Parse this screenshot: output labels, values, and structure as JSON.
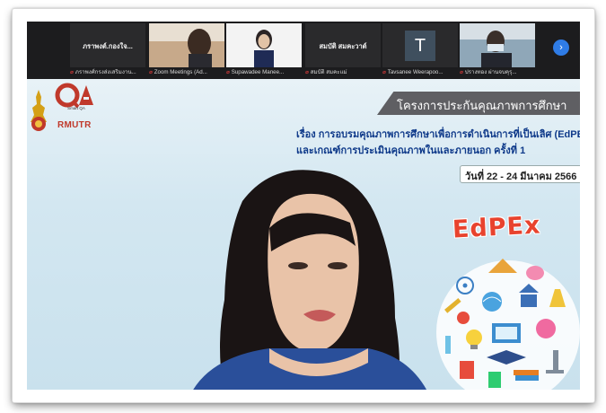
{
  "participants": [
    {
      "tile_label": "ภราพงต์.กองใจ...",
      "caption": "ภราพงศ์กรงส่งเสริมงาน...",
      "type": "name"
    },
    {
      "tile_label": "",
      "caption": "Zoom Meetings (Ad...",
      "type": "video"
    },
    {
      "tile_label": "",
      "caption": "Supawadee Manee...",
      "type": "video"
    },
    {
      "tile_label": "สมบัติ สมคะวาต์",
      "caption": "สมบัติ สมคะแม่",
      "type": "name"
    },
    {
      "tile_label": "T",
      "caption": "Tavsanee Weerapoo...",
      "type": "letter"
    },
    {
      "tile_label": "",
      "caption": "ปรางทอง ผ่านจบคุรุ...",
      "type": "video"
    }
  ],
  "next_page_icon": "chevron-right-icon",
  "slide": {
    "org_short": "RMUTR",
    "qa_logo_text": "QA",
    "qa_logo_sub": "Smart QA",
    "banner_title": "โครงการประกันคุณภาพการศึกษา",
    "line1": "เรื่อง การอบรมคุณภาพการศึกษาเพื่อการดำเนินการที่เป็นเลิศ (EdPEx",
    "line2": "และเกณฑ์การประเมินคุณภาพในและภายนอก ครั้งที่ 1",
    "date": "วันที่ 22 - 24 มีนาคม 2566",
    "edpex_label": "EdPEx"
  },
  "colors": {
    "strip": "#1c1c1e",
    "accent_blue": "#2f7ce6",
    "slide_text": "#0f3a8a",
    "edpex_red": "#e8432e",
    "banner_gray": "#5f5f63"
  }
}
